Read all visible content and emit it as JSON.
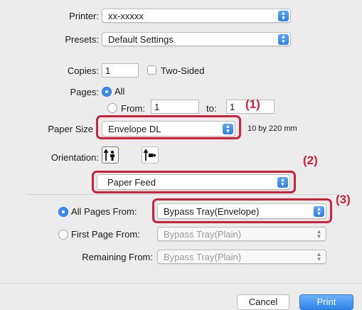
{
  "printer": {
    "label": "Printer:",
    "value": "xx-xxxxx"
  },
  "presets": {
    "label": "Presets:",
    "value": "Default Settings"
  },
  "copies": {
    "label": "Copies:",
    "value": "1"
  },
  "two_sided": {
    "label": "Two-Sided",
    "checked": false
  },
  "pages": {
    "label": "Pages:",
    "all_label": "All",
    "from_label": "From:",
    "from_value": "1",
    "to_label": "to:",
    "to_value": "1"
  },
  "paper_size": {
    "label": "Paper Size",
    "value": "Envelope DL",
    "dimensions": "10 by 220 mm"
  },
  "orientation": {
    "label": "Orientation:"
  },
  "panel_select": {
    "value": "Paper Feed"
  },
  "feed": {
    "all_pages_label": "All Pages From:",
    "all_pages_value": "Bypass Tray(Envelope)",
    "first_page_label": "First Page From:",
    "first_page_value": "Bypass Tray(Plain)",
    "remaining_label": "Remaining From:",
    "remaining_value": "Bypass Tray(Plain)"
  },
  "buttons": {
    "cancel": "Cancel",
    "print": "Print"
  },
  "callouts": {
    "one": "(1)",
    "two": "(2)",
    "three": "(3)"
  },
  "colors": {
    "accent": "#3b8cf0",
    "callout": "#d0203a"
  }
}
